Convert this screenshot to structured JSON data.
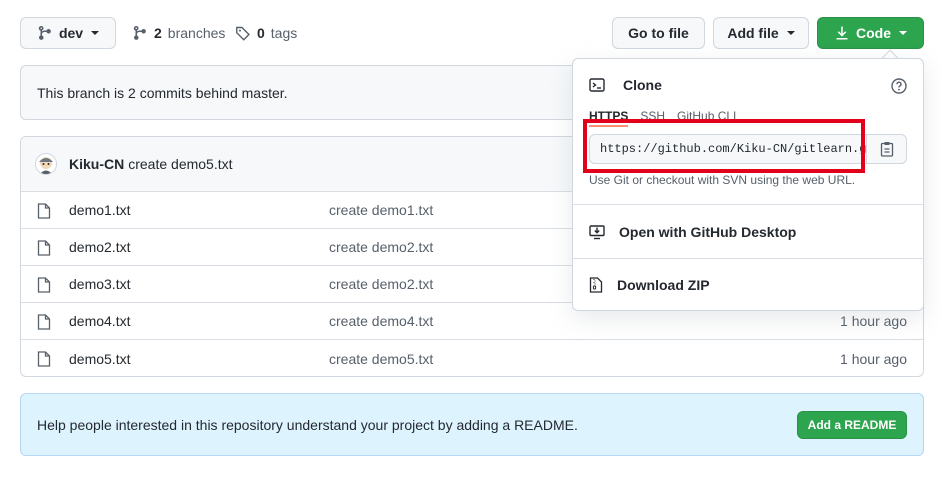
{
  "toolbar": {
    "branch": "dev",
    "branches_count": "2",
    "branches_label": "branches",
    "tags_count": "0",
    "tags_label": "tags",
    "go_to_file": "Go to file",
    "add_file": "Add file",
    "code": "Code"
  },
  "behind_notice": "This branch is 2 commits behind master.",
  "latest_commit": {
    "author": "Kiku-CN",
    "message": "create demo5.txt"
  },
  "files": [
    {
      "name": "demo1.txt",
      "message": "create demo1.txt",
      "age": ""
    },
    {
      "name": "demo2.txt",
      "message": "create demo2.txt",
      "age": ""
    },
    {
      "name": "demo3.txt",
      "message": "create demo2.txt",
      "age": ""
    },
    {
      "name": "demo4.txt",
      "message": "create demo4.txt",
      "age": "1 hour ago"
    },
    {
      "name": "demo5.txt",
      "message": "create demo5.txt",
      "age": "1 hour ago"
    }
  ],
  "readme": {
    "text": "Help people interested in this repository understand your project by adding a README.",
    "button": "Add a README"
  },
  "clone_popover": {
    "title": "Clone",
    "tabs": [
      "HTTPS",
      "SSH",
      "GitHub CLI"
    ],
    "url": "https://github.com/Kiku-CN/gitlearn.git",
    "hint": "Use Git or checkout with SVN using the web URL.",
    "open_desktop": "Open with GitHub Desktop",
    "download_zip": "Download ZIP"
  },
  "colors": {
    "primary_green": "#2da44e",
    "highlight_red": "#e3001b"
  }
}
